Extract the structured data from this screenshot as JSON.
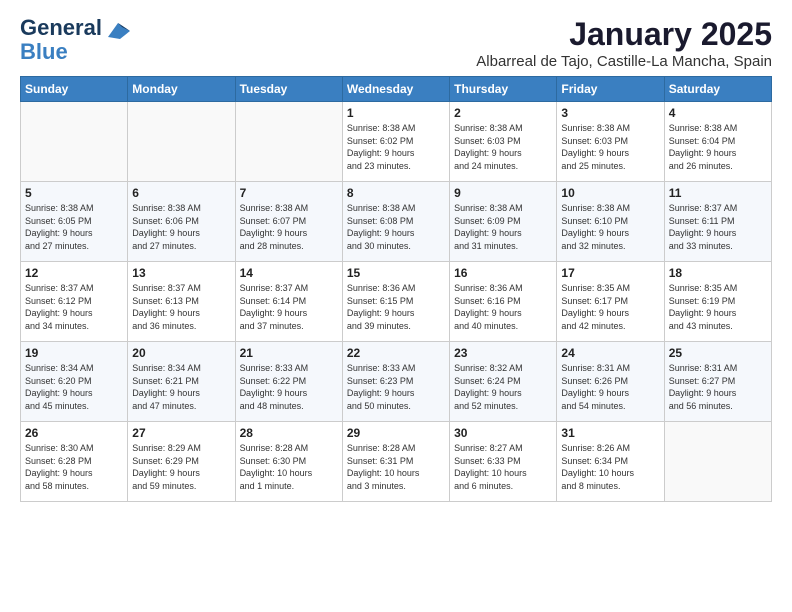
{
  "header": {
    "logo_line1": "General",
    "logo_line2": "Blue",
    "month": "January 2025",
    "location": "Albarreal de Tajo, Castille-La Mancha, Spain"
  },
  "weekdays": [
    "Sunday",
    "Monday",
    "Tuesday",
    "Wednesday",
    "Thursday",
    "Friday",
    "Saturday"
  ],
  "weeks": [
    [
      {
        "day": "",
        "info": ""
      },
      {
        "day": "",
        "info": ""
      },
      {
        "day": "",
        "info": ""
      },
      {
        "day": "1",
        "info": "Sunrise: 8:38 AM\nSunset: 6:02 PM\nDaylight: 9 hours\nand 23 minutes."
      },
      {
        "day": "2",
        "info": "Sunrise: 8:38 AM\nSunset: 6:03 PM\nDaylight: 9 hours\nand 24 minutes."
      },
      {
        "day": "3",
        "info": "Sunrise: 8:38 AM\nSunset: 6:03 PM\nDaylight: 9 hours\nand 25 minutes."
      },
      {
        "day": "4",
        "info": "Sunrise: 8:38 AM\nSunset: 6:04 PM\nDaylight: 9 hours\nand 26 minutes."
      }
    ],
    [
      {
        "day": "5",
        "info": "Sunrise: 8:38 AM\nSunset: 6:05 PM\nDaylight: 9 hours\nand 27 minutes."
      },
      {
        "day": "6",
        "info": "Sunrise: 8:38 AM\nSunset: 6:06 PM\nDaylight: 9 hours\nand 27 minutes."
      },
      {
        "day": "7",
        "info": "Sunrise: 8:38 AM\nSunset: 6:07 PM\nDaylight: 9 hours\nand 28 minutes."
      },
      {
        "day": "8",
        "info": "Sunrise: 8:38 AM\nSunset: 6:08 PM\nDaylight: 9 hours\nand 30 minutes."
      },
      {
        "day": "9",
        "info": "Sunrise: 8:38 AM\nSunset: 6:09 PM\nDaylight: 9 hours\nand 31 minutes."
      },
      {
        "day": "10",
        "info": "Sunrise: 8:38 AM\nSunset: 6:10 PM\nDaylight: 9 hours\nand 32 minutes."
      },
      {
        "day": "11",
        "info": "Sunrise: 8:37 AM\nSunset: 6:11 PM\nDaylight: 9 hours\nand 33 minutes."
      }
    ],
    [
      {
        "day": "12",
        "info": "Sunrise: 8:37 AM\nSunset: 6:12 PM\nDaylight: 9 hours\nand 34 minutes."
      },
      {
        "day": "13",
        "info": "Sunrise: 8:37 AM\nSunset: 6:13 PM\nDaylight: 9 hours\nand 36 minutes."
      },
      {
        "day": "14",
        "info": "Sunrise: 8:37 AM\nSunset: 6:14 PM\nDaylight: 9 hours\nand 37 minutes."
      },
      {
        "day": "15",
        "info": "Sunrise: 8:36 AM\nSunset: 6:15 PM\nDaylight: 9 hours\nand 39 minutes."
      },
      {
        "day": "16",
        "info": "Sunrise: 8:36 AM\nSunset: 6:16 PM\nDaylight: 9 hours\nand 40 minutes."
      },
      {
        "day": "17",
        "info": "Sunrise: 8:35 AM\nSunset: 6:17 PM\nDaylight: 9 hours\nand 42 minutes."
      },
      {
        "day": "18",
        "info": "Sunrise: 8:35 AM\nSunset: 6:19 PM\nDaylight: 9 hours\nand 43 minutes."
      }
    ],
    [
      {
        "day": "19",
        "info": "Sunrise: 8:34 AM\nSunset: 6:20 PM\nDaylight: 9 hours\nand 45 minutes."
      },
      {
        "day": "20",
        "info": "Sunrise: 8:34 AM\nSunset: 6:21 PM\nDaylight: 9 hours\nand 47 minutes."
      },
      {
        "day": "21",
        "info": "Sunrise: 8:33 AM\nSunset: 6:22 PM\nDaylight: 9 hours\nand 48 minutes."
      },
      {
        "day": "22",
        "info": "Sunrise: 8:33 AM\nSunset: 6:23 PM\nDaylight: 9 hours\nand 50 minutes."
      },
      {
        "day": "23",
        "info": "Sunrise: 8:32 AM\nSunset: 6:24 PM\nDaylight: 9 hours\nand 52 minutes."
      },
      {
        "day": "24",
        "info": "Sunrise: 8:31 AM\nSunset: 6:26 PM\nDaylight: 9 hours\nand 54 minutes."
      },
      {
        "day": "25",
        "info": "Sunrise: 8:31 AM\nSunset: 6:27 PM\nDaylight: 9 hours\nand 56 minutes."
      }
    ],
    [
      {
        "day": "26",
        "info": "Sunrise: 8:30 AM\nSunset: 6:28 PM\nDaylight: 9 hours\nand 58 minutes."
      },
      {
        "day": "27",
        "info": "Sunrise: 8:29 AM\nSunset: 6:29 PM\nDaylight: 9 hours\nand 59 minutes."
      },
      {
        "day": "28",
        "info": "Sunrise: 8:28 AM\nSunset: 6:30 PM\nDaylight: 10 hours\nand 1 minute."
      },
      {
        "day": "29",
        "info": "Sunrise: 8:28 AM\nSunset: 6:31 PM\nDaylight: 10 hours\nand 3 minutes."
      },
      {
        "day": "30",
        "info": "Sunrise: 8:27 AM\nSunset: 6:33 PM\nDaylight: 10 hours\nand 6 minutes."
      },
      {
        "day": "31",
        "info": "Sunrise: 8:26 AM\nSunset: 6:34 PM\nDaylight: 10 hours\nand 8 minutes."
      },
      {
        "day": "",
        "info": ""
      }
    ]
  ]
}
